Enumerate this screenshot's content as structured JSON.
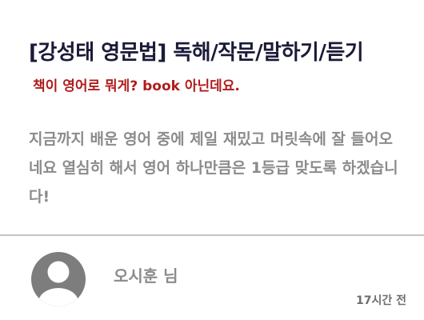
{
  "post": {
    "title": "[강성태 영문법] 독해/작문/말하기/듣기",
    "subtitle": "책이 영어로 뭐게? book 아닌데요.",
    "body": "지금까지 배운 영어 중에 제일 재밌고 머릿속에 잘 들어오네요 열심히 해서 영어 하나만큼은 1등급 맞도록 하겠습니다!"
  },
  "review": {
    "author": "오시훈 님",
    "timestamp": "17시간 전",
    "avatar_icon": "user-avatar-icon",
    "avatar_color": "#7d7d7d"
  },
  "colors": {
    "title": "#1a1a38",
    "subtitle": "#b01c1c",
    "body": "#8b8b8b",
    "divider": "#c4c4c4"
  }
}
